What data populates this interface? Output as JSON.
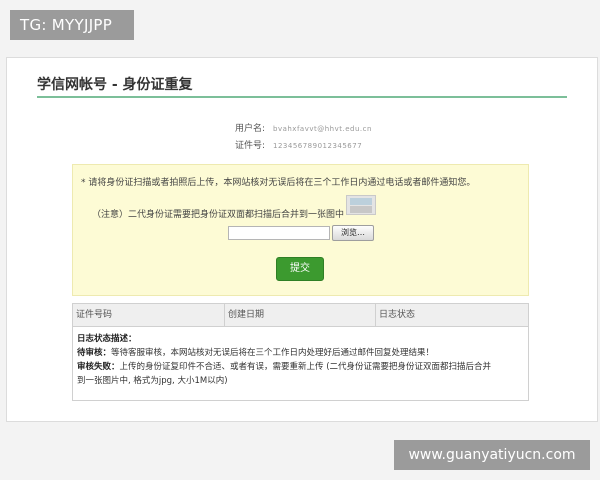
{
  "overlay": {
    "tg_badge": "TG: MYYJJPP",
    "watermark": "www.guanyatiyucn.com"
  },
  "page": {
    "title": "学信网帐号 - 身份证重复"
  },
  "account": {
    "username_label": "用户名:",
    "username_value": "bvahxfavvt@hhvt.edu.cn",
    "idnumber_label": "证件号:",
    "idnumber_value": "123456789012345677"
  },
  "upload": {
    "notice": "* 请将身份证扫描或者拍照后上传，本网站核对无误后将在三个工作日内通过电话或者邮件通知您。",
    "note": "（注意）二代身份证需要把身份证双面都扫描后合并到一张图中",
    "browse_label": "浏览…",
    "submit_label": "提交"
  },
  "table": {
    "headers": [
      "证件号码",
      "创建日期",
      "日志状态"
    ],
    "desc_title": "日志状态描述：",
    "pending_label": "待审核：",
    "pending_text": "等待客服审核，本网站核对无误后将在三个工作日内处理好后通过邮件回复处理结果！",
    "failed_label": "审核失败：",
    "failed_text_1": "上传的身份证复印件不合适、或者有误，需要重新上传 (二代身份证需要把身份证双面都扫描后合并",
    "failed_text_2": "到一张图片中, 格式为jpg, 大小1M以内)"
  }
}
